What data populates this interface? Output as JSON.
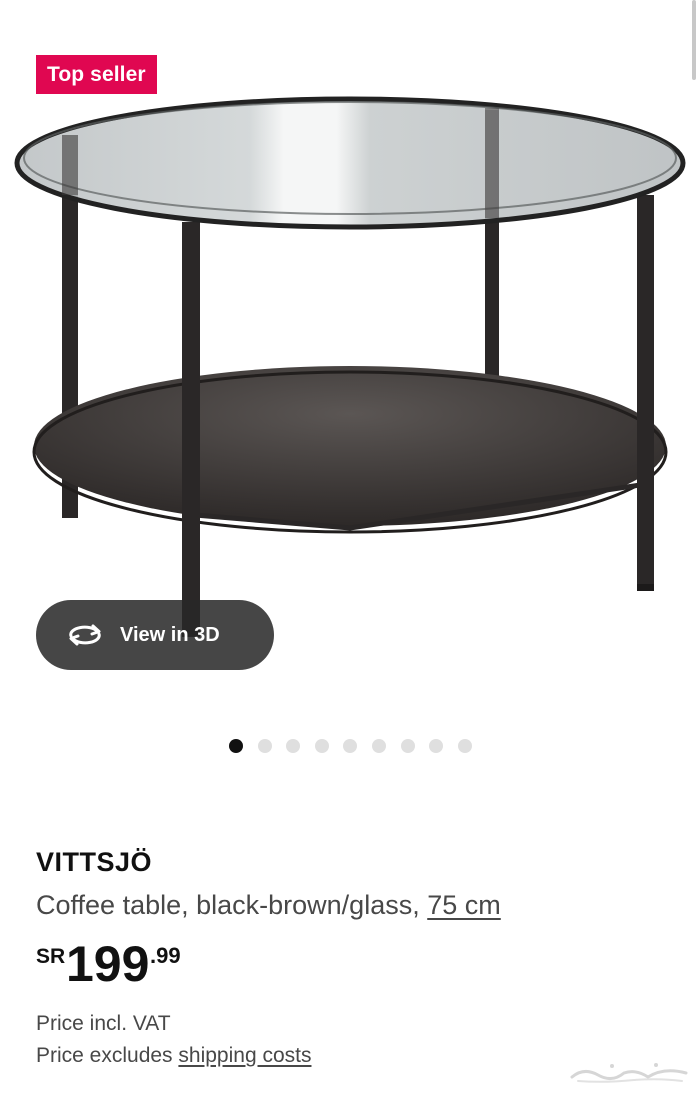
{
  "badge": {
    "label": "Top seller"
  },
  "view3d": {
    "label": "View in 3D",
    "icon": "rotate-3d-icon"
  },
  "gallery": {
    "total_images": 9,
    "active_index": 0
  },
  "product": {
    "name": "VITTSJÖ",
    "description": "Coffee table, black-brown/glass,",
    "size_link": "75 cm",
    "price": {
      "currency": "SR",
      "integer": "199",
      "decimal": ".99"
    },
    "vat_note": "Price incl. VAT",
    "shipping_prefix": "Price excludes",
    "shipping_link": "shipping costs"
  },
  "colors": {
    "badge": "#e00751",
    "frame": "#2a2727",
    "shelf": "#3a3635",
    "text": "#111111",
    "muted": "#484848"
  }
}
